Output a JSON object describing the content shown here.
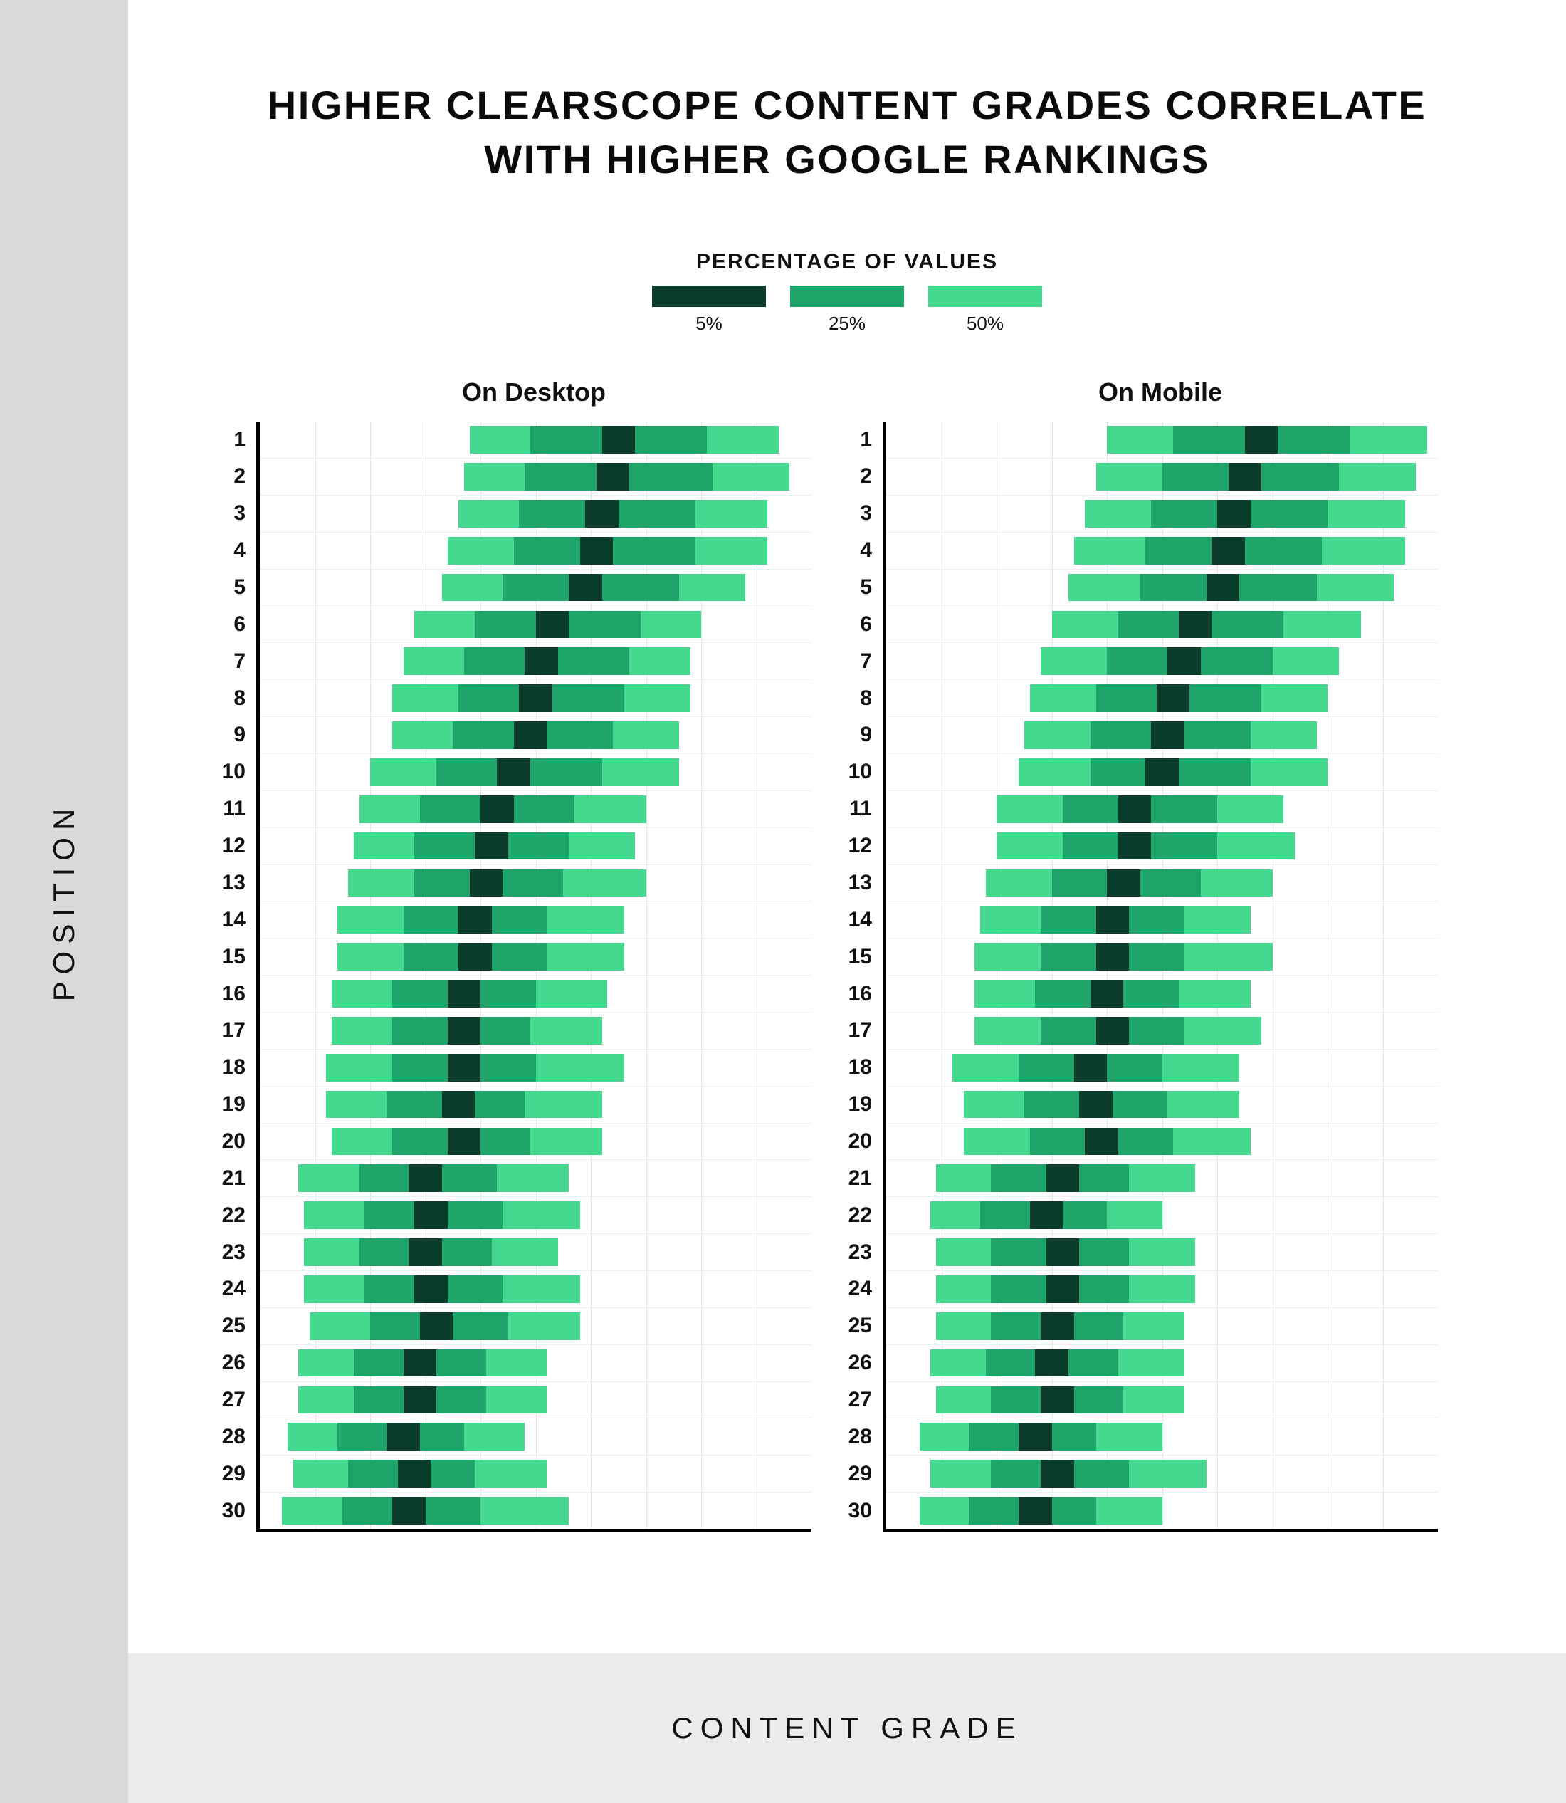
{
  "title_line1": "HIGHER CLEARSCOPE CONTENT GRADES CORRELATE",
  "title_line2": "WITH HIGHER GOOGLE RANKINGS",
  "legend": {
    "title": "PERCENTAGE OF VALUES",
    "items": [
      {
        "label": "5%",
        "color": "#0c3d2c"
      },
      {
        "label": "25%",
        "color": "#1fa56a"
      },
      {
        "label": "50%",
        "color": "#45d98f"
      }
    ]
  },
  "ylabel": "POSITION",
  "xlabel": "CONTENT GRADE",
  "panels": [
    {
      "title": "On Desktop",
      "key": "desktop"
    },
    {
      "title": "On Mobile",
      "key": "mobile"
    }
  ],
  "x_domain": [
    0,
    100
  ],
  "chart_data": {
    "type": "bar",
    "note": "Horizontal stacked percentile bars. For each position (1–30), low50/high50 bound the 50% band, low25/high25 the 25% band, low5/high5 the 5% band. Values estimated from the image on a 0–100 content-grade scale.",
    "positions": [
      1,
      2,
      3,
      4,
      5,
      6,
      7,
      8,
      9,
      10,
      11,
      12,
      13,
      14,
      15,
      16,
      17,
      18,
      19,
      20,
      21,
      22,
      23,
      24,
      25,
      26,
      27,
      28,
      29,
      30
    ],
    "desktop": [
      {
        "pos": 1,
        "low50": 38,
        "high50": 94,
        "low25": 49,
        "high25": 81,
        "low5": 62,
        "high5": 68
      },
      {
        "pos": 2,
        "low50": 37,
        "high50": 96,
        "low25": 48,
        "high25": 82,
        "low5": 61,
        "high5": 67
      },
      {
        "pos": 3,
        "low50": 36,
        "high50": 92,
        "low25": 47,
        "high25": 79,
        "low5": 59,
        "high5": 65
      },
      {
        "pos": 4,
        "low50": 34,
        "high50": 92,
        "low25": 46,
        "high25": 79,
        "low5": 58,
        "high5": 64
      },
      {
        "pos": 5,
        "low50": 33,
        "high50": 88,
        "low25": 44,
        "high25": 76,
        "low5": 56,
        "high5": 62
      },
      {
        "pos": 6,
        "low50": 28,
        "high50": 80,
        "low25": 39,
        "high25": 69,
        "low5": 50,
        "high5": 56
      },
      {
        "pos": 7,
        "low50": 26,
        "high50": 78,
        "low25": 37,
        "high25": 67,
        "low5": 48,
        "high5": 54
      },
      {
        "pos": 8,
        "low50": 24,
        "high50": 78,
        "low25": 36,
        "high25": 66,
        "low5": 47,
        "high5": 53
      },
      {
        "pos": 9,
        "low50": 24,
        "high50": 76,
        "low25": 35,
        "high25": 64,
        "low5": 46,
        "high5": 52
      },
      {
        "pos": 10,
        "low50": 20,
        "high50": 76,
        "low25": 32,
        "high25": 62,
        "low5": 43,
        "high5": 49
      },
      {
        "pos": 11,
        "low50": 18,
        "high50": 70,
        "low25": 29,
        "high25": 57,
        "low5": 40,
        "high5": 46
      },
      {
        "pos": 12,
        "low50": 17,
        "high50": 68,
        "low25": 28,
        "high25": 56,
        "low5": 39,
        "high5": 45
      },
      {
        "pos": 13,
        "low50": 16,
        "high50": 70,
        "low25": 28,
        "high25": 55,
        "low5": 38,
        "high5": 44
      },
      {
        "pos": 14,
        "low50": 14,
        "high50": 66,
        "low25": 26,
        "high25": 52,
        "low5": 36,
        "high5": 42
      },
      {
        "pos": 15,
        "low50": 14,
        "high50": 66,
        "low25": 26,
        "high25": 52,
        "low5": 36,
        "high5": 42
      },
      {
        "pos": 16,
        "low50": 13,
        "high50": 63,
        "low25": 24,
        "high25": 50,
        "low5": 34,
        "high5": 40
      },
      {
        "pos": 17,
        "low50": 13,
        "high50": 62,
        "low25": 24,
        "high25": 49,
        "low5": 34,
        "high5": 40
      },
      {
        "pos": 18,
        "low50": 12,
        "high50": 66,
        "low25": 24,
        "high25": 50,
        "low5": 34,
        "high5": 40
      },
      {
        "pos": 19,
        "low50": 12,
        "high50": 62,
        "low25": 23,
        "high25": 48,
        "low5": 33,
        "high5": 39
      },
      {
        "pos": 20,
        "low50": 13,
        "high50": 62,
        "low25": 24,
        "high25": 49,
        "low5": 34,
        "high5": 40
      },
      {
        "pos": 21,
        "low50": 7,
        "high50": 56,
        "low25": 18,
        "high25": 43,
        "low5": 27,
        "high5": 33
      },
      {
        "pos": 22,
        "low50": 8,
        "high50": 58,
        "low25": 19,
        "high25": 44,
        "low5": 28,
        "high5": 34
      },
      {
        "pos": 23,
        "low50": 8,
        "high50": 54,
        "low25": 18,
        "high25": 42,
        "low5": 27,
        "high5": 33
      },
      {
        "pos": 24,
        "low50": 8,
        "high50": 58,
        "low25": 19,
        "high25": 44,
        "low5": 28,
        "high5": 34
      },
      {
        "pos": 25,
        "low50": 9,
        "high50": 58,
        "low25": 20,
        "high25": 45,
        "low5": 29,
        "high5": 35
      },
      {
        "pos": 26,
        "low50": 7,
        "high50": 52,
        "low25": 17,
        "high25": 41,
        "low5": 26,
        "high5": 32
      },
      {
        "pos": 27,
        "low50": 7,
        "high50": 52,
        "low25": 17,
        "high25": 41,
        "low5": 26,
        "high5": 32
      },
      {
        "pos": 28,
        "low50": 5,
        "high50": 48,
        "low25": 14,
        "high25": 37,
        "low5": 23,
        "high5": 29
      },
      {
        "pos": 29,
        "low50": 6,
        "high50": 52,
        "low25": 16,
        "high25": 39,
        "low5": 25,
        "high5": 31
      },
      {
        "pos": 30,
        "low50": 4,
        "high50": 56,
        "low25": 15,
        "high25": 40,
        "low5": 24,
        "high5": 30
      }
    ],
    "mobile": [
      {
        "pos": 1,
        "low50": 40,
        "high50": 98,
        "low25": 52,
        "high25": 84,
        "low5": 65,
        "high5": 71
      },
      {
        "pos": 2,
        "low50": 38,
        "high50": 96,
        "low25": 50,
        "high25": 82,
        "low5": 62,
        "high5": 68
      },
      {
        "pos": 3,
        "low50": 36,
        "high50": 94,
        "low25": 48,
        "high25": 80,
        "low5": 60,
        "high5": 66
      },
      {
        "pos": 4,
        "low50": 34,
        "high50": 94,
        "low25": 47,
        "high25": 79,
        "low5": 59,
        "high5": 65
      },
      {
        "pos": 5,
        "low50": 33,
        "high50": 92,
        "low25": 46,
        "high25": 78,
        "low5": 58,
        "high5": 64
      },
      {
        "pos": 6,
        "low50": 30,
        "high50": 86,
        "low25": 42,
        "high25": 72,
        "low5": 53,
        "high5": 59
      },
      {
        "pos": 7,
        "low50": 28,
        "high50": 82,
        "low25": 40,
        "high25": 70,
        "low5": 51,
        "high5": 57
      },
      {
        "pos": 8,
        "low50": 26,
        "high50": 80,
        "low25": 38,
        "high25": 68,
        "low5": 49,
        "high5": 55
      },
      {
        "pos": 9,
        "low50": 25,
        "high50": 78,
        "low25": 37,
        "high25": 66,
        "low5": 48,
        "high5": 54
      },
      {
        "pos": 10,
        "low50": 24,
        "high50": 80,
        "low25": 37,
        "high25": 66,
        "low5": 47,
        "high5": 53
      },
      {
        "pos": 11,
        "low50": 20,
        "high50": 72,
        "low25": 32,
        "high25": 60,
        "low5": 42,
        "high5": 48
      },
      {
        "pos": 12,
        "low50": 20,
        "high50": 74,
        "low25": 32,
        "high25": 60,
        "low5": 42,
        "high5": 48
      },
      {
        "pos": 13,
        "low50": 18,
        "high50": 70,
        "low25": 30,
        "high25": 57,
        "low5": 40,
        "high5": 46
      },
      {
        "pos": 14,
        "low50": 17,
        "high50": 66,
        "low25": 28,
        "high25": 54,
        "low5": 38,
        "high5": 44
      },
      {
        "pos": 15,
        "low50": 16,
        "high50": 70,
        "low25": 28,
        "high25": 54,
        "low5": 38,
        "high5": 44
      },
      {
        "pos": 16,
        "low50": 16,
        "high50": 66,
        "low25": 27,
        "high25": 53,
        "low5": 37,
        "high5": 43
      },
      {
        "pos": 17,
        "low50": 16,
        "high50": 68,
        "low25": 28,
        "high25": 54,
        "low5": 38,
        "high5": 44
      },
      {
        "pos": 18,
        "low50": 12,
        "high50": 64,
        "low25": 24,
        "high25": 50,
        "low5": 34,
        "high5": 40
      },
      {
        "pos": 19,
        "low50": 14,
        "high50": 64,
        "low25": 25,
        "high25": 51,
        "low5": 35,
        "high5": 41
      },
      {
        "pos": 20,
        "low50": 14,
        "high50": 66,
        "low25": 26,
        "high25": 52,
        "low5": 36,
        "high5": 42
      },
      {
        "pos": 21,
        "low50": 9,
        "high50": 56,
        "low25": 19,
        "high25": 44,
        "low5": 29,
        "high5": 35
      },
      {
        "pos": 22,
        "low50": 8,
        "high50": 50,
        "low25": 17,
        "high25": 40,
        "low5": 26,
        "high5": 32
      },
      {
        "pos": 23,
        "low50": 9,
        "high50": 56,
        "low25": 19,
        "high25": 44,
        "low5": 29,
        "high5": 35
      },
      {
        "pos": 24,
        "low50": 9,
        "high50": 56,
        "low25": 19,
        "high25": 44,
        "low5": 29,
        "high5": 35
      },
      {
        "pos": 25,
        "low50": 9,
        "high50": 54,
        "low25": 19,
        "high25": 43,
        "low5": 28,
        "high5": 34
      },
      {
        "pos": 26,
        "low50": 8,
        "high50": 54,
        "low25": 18,
        "high25": 42,
        "low5": 27,
        "high5": 33
      },
      {
        "pos": 27,
        "low50": 9,
        "high50": 54,
        "low25": 19,
        "high25": 43,
        "low5": 28,
        "high5": 34
      },
      {
        "pos": 28,
        "low50": 6,
        "high50": 50,
        "low25": 15,
        "high25": 38,
        "low5": 24,
        "high5": 30
      },
      {
        "pos": 29,
        "low50": 8,
        "high50": 58,
        "low25": 19,
        "high25": 44,
        "low5": 28,
        "high5": 34
      },
      {
        "pos": 30,
        "low50": 6,
        "high50": 50,
        "low25": 15,
        "high25": 38,
        "low5": 24,
        "high5": 30
      }
    ]
  }
}
